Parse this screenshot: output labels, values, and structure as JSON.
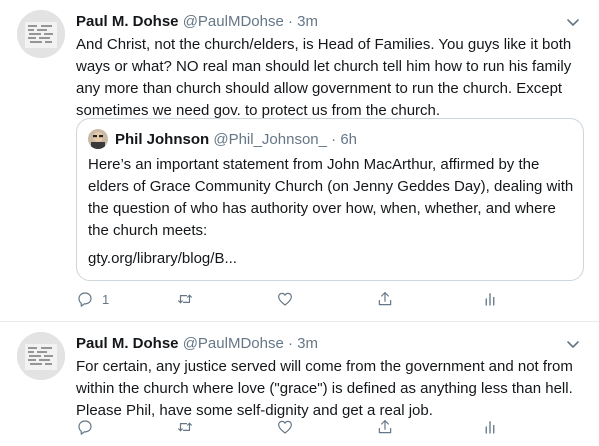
{
  "tweets": [
    {
      "author": {
        "name": "Paul M. Dohse",
        "handle": "@PaulMDohse",
        "dot": "·",
        "time": "3m"
      },
      "lines": [
        "And Christ, not the church/elders, is Head of Families. You guys like it both",
        "ways or what? NO real man should let church tell him how to run his family",
        "any more than church should allow government to run the church. Except",
        "sometimes we need gov. to protect us from the church."
      ],
      "quote": {
        "name": "Phil Johnson",
        "handle": "@Phil_Johnson_",
        "dot": "·",
        "time": "6h",
        "lines": [
          "Here’s an important statement from John MacArthur, affirmed by the",
          "elders of Grace Community Church (on Jenny Geddes Day), dealing with",
          "the question of who has authority over how, when, whether, and where",
          "the church meets:"
        ],
        "link": "gty.org/library/blog/B..."
      },
      "actions": {
        "reply_count": "1",
        "icons": [
          "reply-icon",
          "retweet-icon",
          "like-icon",
          "share-icon",
          "analytics-icon"
        ]
      }
    },
    {
      "author": {
        "name": "Paul M. Dohse",
        "handle": "@PaulMDohse",
        "dot": "·",
        "time": "3m"
      },
      "lines": [
        "For certain, any justice served will come from the government and not from",
        "within the church where love (\"grace\") is defined as anything less than hell.",
        "Please Phil, have some self-dignity and get a real job."
      ],
      "actions": {
        "icons": [
          "reply-icon",
          "retweet-icon",
          "like-icon",
          "share-icon",
          "analytics-icon"
        ]
      }
    }
  ],
  "colors": {
    "text": "#14171a",
    "secondary": "#657786",
    "border": "#ccd6dd",
    "divider": "#e6ecf0"
  }
}
